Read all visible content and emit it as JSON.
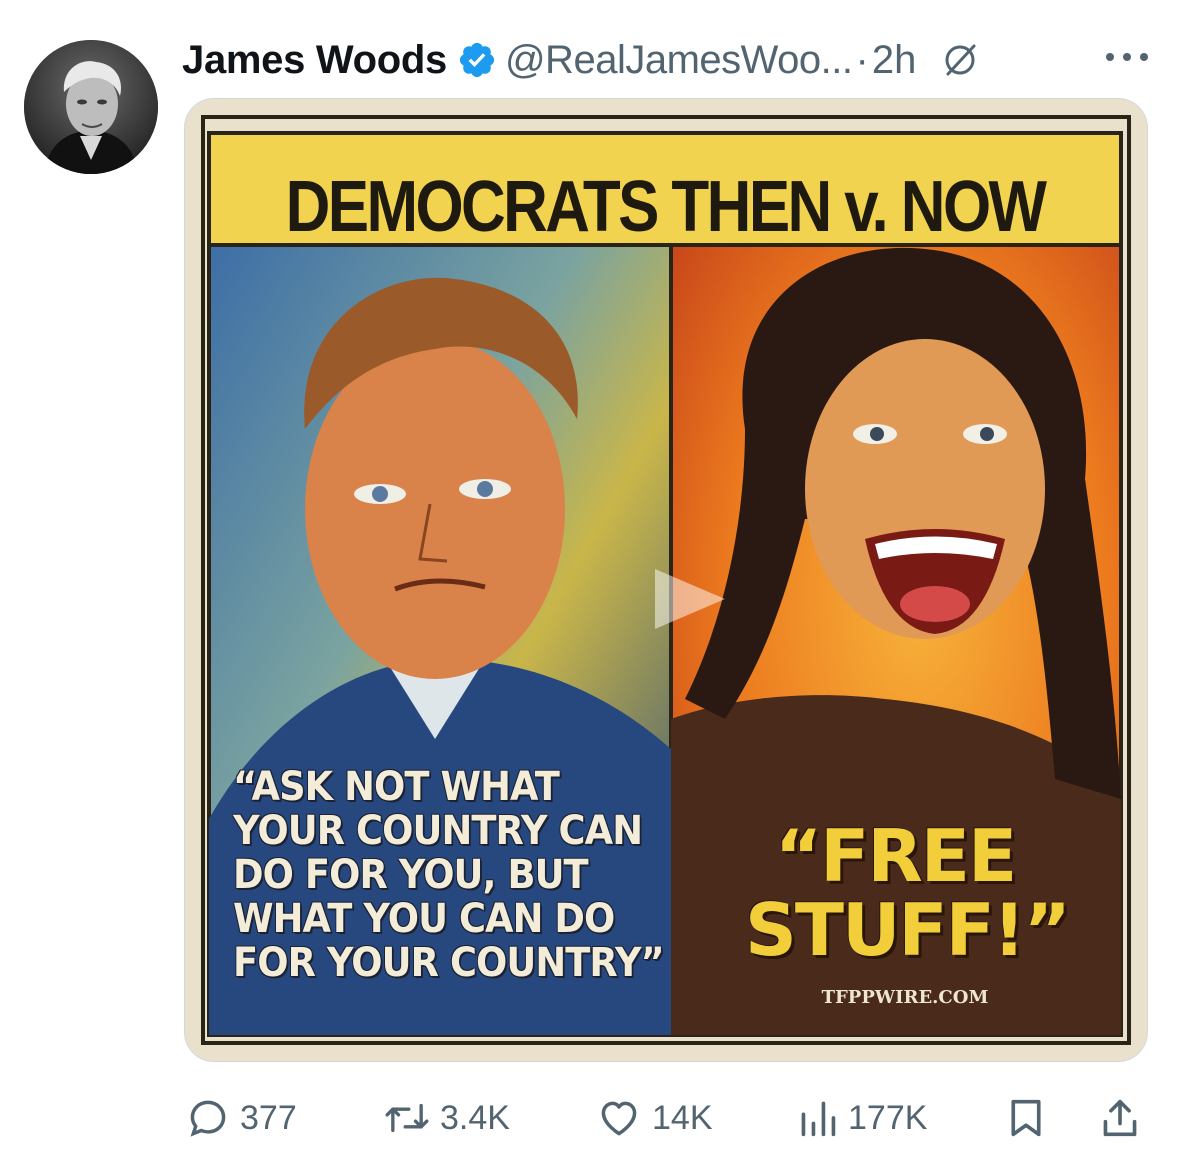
{
  "post": {
    "author_name": "James Woods",
    "handle": "@RealJamesWoo...",
    "separator": "·",
    "time": "2h",
    "verified": true,
    "icons": {
      "avatar": "profile-photo",
      "verified": "verified-badge-icon",
      "grok": "grok-icon",
      "more": "more-icon"
    }
  },
  "media": {
    "title": "DEMOCRATS THEN v. NOW",
    "left_quote": [
      "“ASK NOT WHAT",
      "YOUR COUNTRY CAN",
      "DO FOR YOU, BUT",
      "WHAT YOU CAN DO",
      "FOR YOUR COUNTRY”"
    ],
    "right_quote": [
      "“FREE",
      "STUFF!”"
    ],
    "watermark": "TFPPWIRE.COM",
    "colors": {
      "banner": "#f2d34f",
      "left_panel": "#2f5a8c",
      "right_panel": "#e9731f",
      "right_quote_text": "#f2cf3a"
    }
  },
  "actions": {
    "reply_count": "377",
    "repost_count": "3.4K",
    "like_count": "14K",
    "view_count": "177K",
    "icons": [
      "reply-icon",
      "repost-icon",
      "like-icon",
      "views-icon",
      "bookmark-icon",
      "share-icon"
    ]
  },
  "theme": {
    "text_primary": "#0f1419",
    "text_secondary": "#536471",
    "verified_blue": "#1d9bf0"
  }
}
